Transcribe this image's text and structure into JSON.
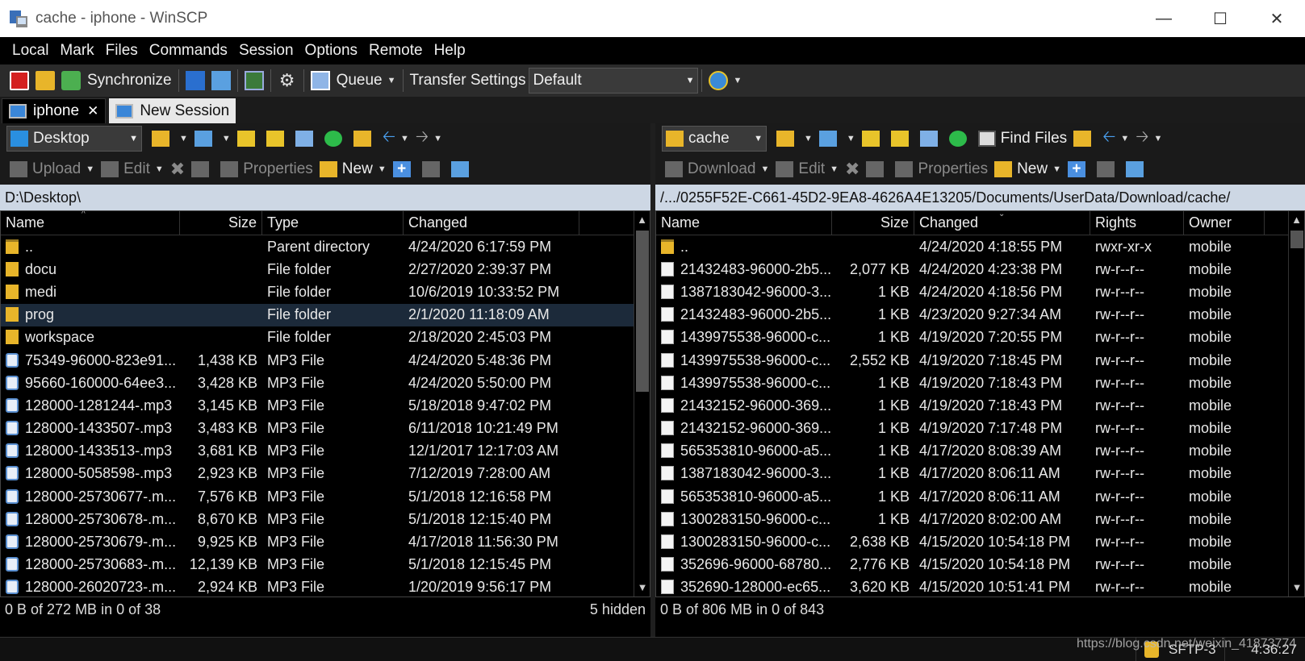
{
  "window": {
    "title": "cache - iphone - WinSCP",
    "controls": [
      "minimize-icon",
      "maximize-icon",
      "close-icon"
    ]
  },
  "menu": [
    "Local",
    "Mark",
    "Files",
    "Commands",
    "Session",
    "Options",
    "Remote",
    "Help"
  ],
  "toolbar": {
    "synchronize_label": "Synchronize",
    "queue_label": "Queue",
    "transfer_settings_label": "Transfer Settings",
    "transfer_settings_value": "Default"
  },
  "tabs": [
    {
      "label": "iphone",
      "active": true
    },
    {
      "label": "New Session",
      "active": false
    }
  ],
  "left": {
    "location": "Desktop",
    "upload_label": "Upload",
    "edit_label": "Edit",
    "properties_label": "Properties",
    "new_label": "New",
    "path": "D:\\Desktop\\",
    "columns": {
      "name": "Name",
      "size": "Size",
      "type": "Type",
      "changed": "Changed"
    },
    "rows": [
      {
        "name": "..",
        "size": "",
        "type": "Parent directory",
        "changed": "4/24/2020  6:17:59 PM",
        "icon": "parent"
      },
      {
        "name": "docu",
        "size": "",
        "type": "File folder",
        "changed": "2/27/2020  2:39:37 PM",
        "icon": "folder"
      },
      {
        "name": "medi",
        "size": "",
        "type": "File folder",
        "changed": "10/6/2019  10:33:52 PM",
        "icon": "folder"
      },
      {
        "name": "prog",
        "size": "",
        "type": "File folder",
        "changed": "2/1/2020  11:18:09 AM",
        "icon": "folder"
      },
      {
        "name": "workspace",
        "size": "",
        "type": "File folder",
        "changed": "2/18/2020  2:45:03 PM",
        "icon": "folder"
      },
      {
        "name": "75349-96000-823e91...",
        "size": "1,438 KB",
        "type": "MP3 File",
        "changed": "4/24/2020  5:48:36 PM",
        "icon": "mp3"
      },
      {
        "name": "95660-160000-64ee3...",
        "size": "3,428 KB",
        "type": "MP3 File",
        "changed": "4/24/2020  5:50:00 PM",
        "icon": "mp3"
      },
      {
        "name": "128000-1281244-.mp3",
        "size": "3,145 KB",
        "type": "MP3 File",
        "changed": "5/18/2018  9:47:02 PM",
        "icon": "mp3"
      },
      {
        "name": "128000-1433507-.mp3",
        "size": "3,483 KB",
        "type": "MP3 File",
        "changed": "6/11/2018  10:21:49 PM",
        "icon": "mp3"
      },
      {
        "name": "128000-1433513-.mp3",
        "size": "3,681 KB",
        "type": "MP3 File",
        "changed": "12/1/2017  12:17:03 AM",
        "icon": "mp3"
      },
      {
        "name": "128000-5058598-.mp3",
        "size": "2,923 KB",
        "type": "MP3 File",
        "changed": "7/12/2019  7:28:00 AM",
        "icon": "mp3"
      },
      {
        "name": "128000-25730677-.m...",
        "size": "7,576 KB",
        "type": "MP3 File",
        "changed": "5/1/2018  12:16:58 PM",
        "icon": "mp3"
      },
      {
        "name": "128000-25730678-.m...",
        "size": "8,670 KB",
        "type": "MP3 File",
        "changed": "5/1/2018  12:15:40 PM",
        "icon": "mp3"
      },
      {
        "name": "128000-25730679-.m...",
        "size": "9,925 KB",
        "type": "MP3 File",
        "changed": "4/17/2018  11:56:30 PM",
        "icon": "mp3"
      },
      {
        "name": "128000-25730683-.m...",
        "size": "12,139 KB",
        "type": "MP3 File",
        "changed": "5/1/2018  12:15:45 PM",
        "icon": "mp3"
      },
      {
        "name": "128000-26020723-.m...",
        "size": "2,924 KB",
        "type": "MP3 File",
        "changed": "1/20/2019  9:56:17 PM",
        "icon": "mp3"
      }
    ],
    "status": "0 B of 272 MB in 0 of 38",
    "hidden": "5 hidden"
  },
  "right": {
    "location": "cache",
    "find_files_label": "Find Files",
    "download_label": "Download",
    "edit_label": "Edit",
    "properties_label": "Properties",
    "new_label": "New",
    "path": "/.../0255F52E-C661-45D2-9EA8-4626A4E13205/Documents/UserData/Download/cache/",
    "columns": {
      "name": "Name",
      "size": "Size",
      "changed": "Changed",
      "rights": "Rights",
      "owner": "Owner"
    },
    "rows": [
      {
        "name": "..",
        "size": "",
        "changed": "4/24/2020 4:18:55 PM",
        "rights": "rwxr-xr-x",
        "owner": "mobile",
        "icon": "parent"
      },
      {
        "name": "21432483-96000-2b5...",
        "size": "2,077 KB",
        "changed": "4/24/2020 4:23:38 PM",
        "rights": "rw-r--r--",
        "owner": "mobile",
        "icon": "file"
      },
      {
        "name": "1387183042-96000-3...",
        "size": "1 KB",
        "changed": "4/24/2020 4:18:56 PM",
        "rights": "rw-r--r--",
        "owner": "mobile",
        "icon": "file"
      },
      {
        "name": "21432483-96000-2b5...",
        "size": "1 KB",
        "changed": "4/23/2020 9:27:34 AM",
        "rights": "rw-r--r--",
        "owner": "mobile",
        "icon": "file"
      },
      {
        "name": "1439975538-96000-c...",
        "size": "1 KB",
        "changed": "4/19/2020 7:20:55 PM",
        "rights": "rw-r--r--",
        "owner": "mobile",
        "icon": "file"
      },
      {
        "name": "1439975538-96000-c...",
        "size": "2,552 KB",
        "changed": "4/19/2020 7:18:45 PM",
        "rights": "rw-r--r--",
        "owner": "mobile",
        "icon": "file"
      },
      {
        "name": "1439975538-96000-c...",
        "size": "1 KB",
        "changed": "4/19/2020 7:18:43 PM",
        "rights": "rw-r--r--",
        "owner": "mobile",
        "icon": "file"
      },
      {
        "name": "21432152-96000-369...",
        "size": "1 KB",
        "changed": "4/19/2020 7:18:43 PM",
        "rights": "rw-r--r--",
        "owner": "mobile",
        "icon": "file"
      },
      {
        "name": "21432152-96000-369...",
        "size": "1 KB",
        "changed": "4/19/2020 7:17:48 PM",
        "rights": "rw-r--r--",
        "owner": "mobile",
        "icon": "file"
      },
      {
        "name": "565353810-96000-a5...",
        "size": "1 KB",
        "changed": "4/17/2020 8:08:39 AM",
        "rights": "rw-r--r--",
        "owner": "mobile",
        "icon": "file"
      },
      {
        "name": "1387183042-96000-3...",
        "size": "1 KB",
        "changed": "4/17/2020 8:06:11 AM",
        "rights": "rw-r--r--",
        "owner": "mobile",
        "icon": "file"
      },
      {
        "name": "565353810-96000-a5...",
        "size": "1 KB",
        "changed": "4/17/2020 8:06:11 AM",
        "rights": "rw-r--r--",
        "owner": "mobile",
        "icon": "file"
      },
      {
        "name": "1300283150-96000-c...",
        "size": "1 KB",
        "changed": "4/17/2020 8:02:00 AM",
        "rights": "rw-r--r--",
        "owner": "mobile",
        "icon": "file"
      },
      {
        "name": "1300283150-96000-c...",
        "size": "2,638 KB",
        "changed": "4/15/2020 10:54:18 PM",
        "rights": "rw-r--r--",
        "owner": "mobile",
        "icon": "file"
      },
      {
        "name": "352696-96000-68780...",
        "size": "2,776 KB",
        "changed": "4/15/2020 10:54:18 PM",
        "rights": "rw-r--r--",
        "owner": "mobile",
        "icon": "file"
      },
      {
        "name": "352690-128000-ec65...",
        "size": "3,620 KB",
        "changed": "4/15/2020 10:51:41 PM",
        "rights": "rw-r--r--",
        "owner": "mobile",
        "icon": "file"
      }
    ],
    "status": "0 B of 806 MB in 0 of 843"
  },
  "statusbar": {
    "protocol": "SFTP-3",
    "time": "4:36:27",
    "watermark": "https://blog.csdn.net/weixin_41873774"
  }
}
